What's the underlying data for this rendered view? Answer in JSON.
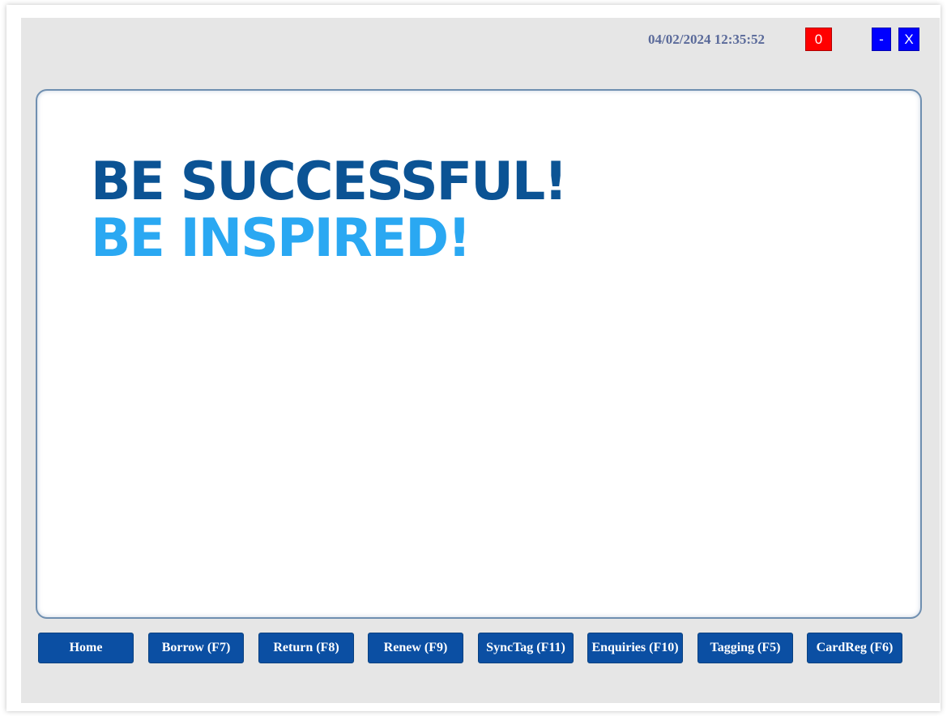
{
  "header": {
    "datetime": "04/02/2024 12:35:52",
    "counter": "0",
    "minimize_label": "-",
    "close_label": "X"
  },
  "banner": {
    "line1": "BE SUCCESSFUL!",
    "line2": "BE INSPIRED!"
  },
  "nav": [
    {
      "label": "Home"
    },
    {
      "label": "Borrow (F7)"
    },
    {
      "label": "Return (F8)"
    },
    {
      "label": "Renew (F9)"
    },
    {
      "label": "SyncTag (F11)"
    },
    {
      "label": "Enquiries (F10)"
    },
    {
      "label": "Tagging (F5)"
    },
    {
      "label": "CardReg (F6)"
    }
  ],
  "colors": {
    "nav_button": "#0b4fa3",
    "counter_badge": "#ff0000",
    "window_button": "#0000ff",
    "slogan_dark": "#0b5394",
    "slogan_light": "#2aa8f2"
  }
}
